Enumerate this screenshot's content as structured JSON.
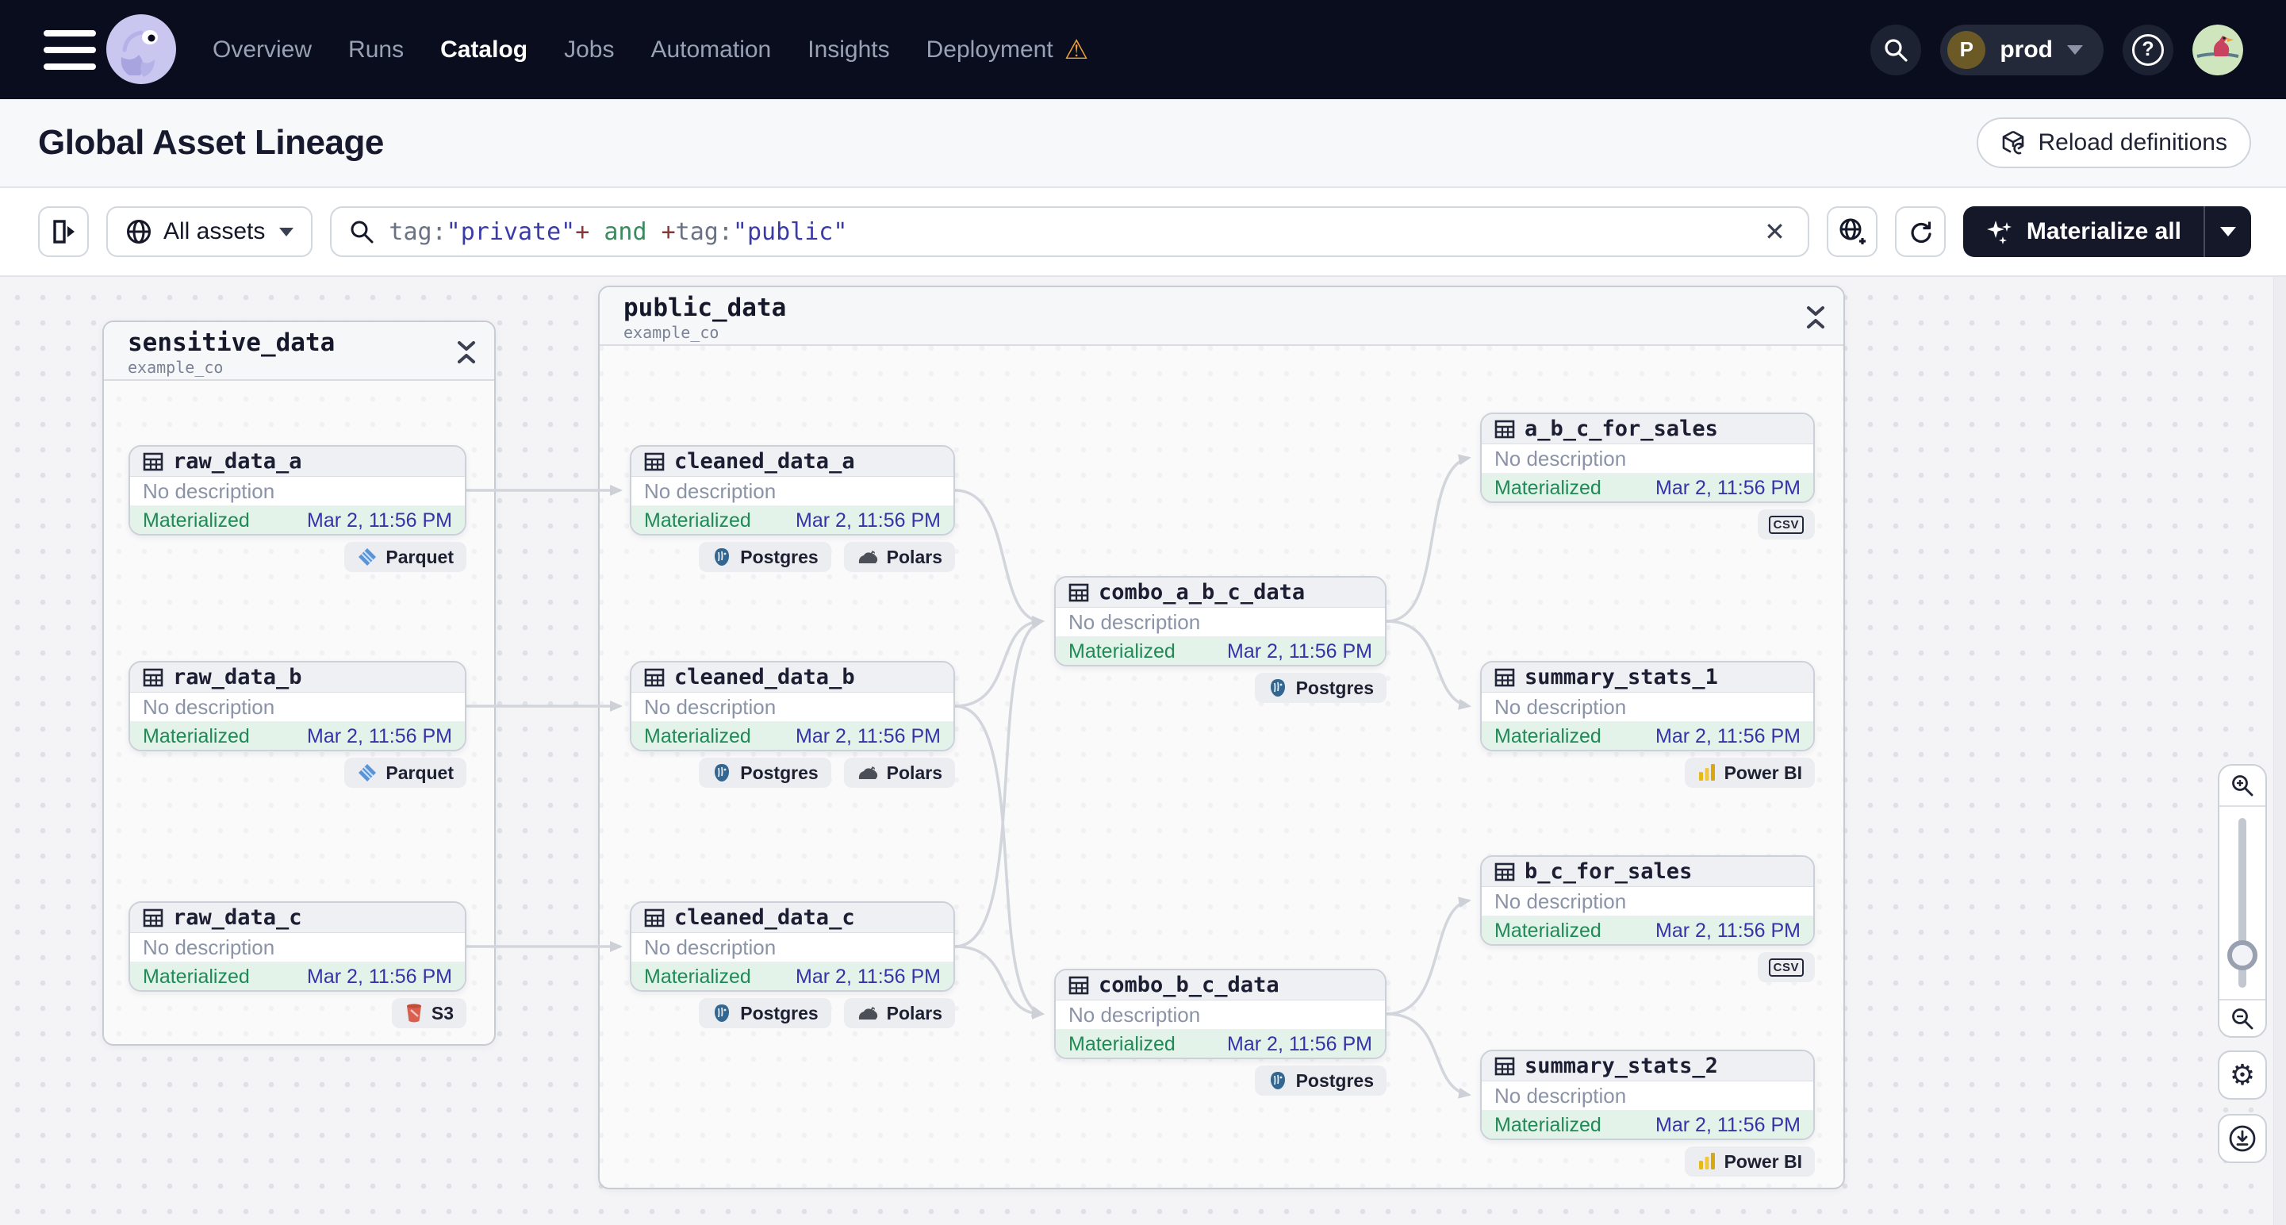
{
  "nav": {
    "items": [
      "Overview",
      "Runs",
      "Catalog",
      "Jobs",
      "Automation",
      "Insights",
      "Deployment"
    ],
    "active_item": "Catalog",
    "deployment_warning_icon": "warning-triangle",
    "environment": {
      "initial": "P",
      "name": "prod"
    }
  },
  "header": {
    "title": "Global Asset Lineage",
    "reload_button_label": "Reload definitions"
  },
  "toolbar": {
    "scope_label": "All assets",
    "query_tokens": [
      {
        "text": "tag:",
        "type": "key"
      },
      {
        "text": "\"private\"",
        "type": "value"
      },
      {
        "text": "+",
        "type": "op"
      },
      {
        "text": " and ",
        "type": "and"
      },
      {
        "text": "+",
        "type": "op"
      },
      {
        "text": "tag:",
        "type": "key"
      },
      {
        "text": "\"public\"",
        "type": "value"
      }
    ],
    "materialize_label": "Materialize all"
  },
  "graph": {
    "groups": [
      {
        "name": "sensitive_data",
        "repo": "example_co"
      },
      {
        "name": "public_data",
        "repo": "example_co"
      }
    ],
    "assets": [
      {
        "name": "raw_data_a",
        "description": "No description",
        "status": "Materialized",
        "date": "Mar 2, 11:56 PM",
        "badges": [
          "Parquet"
        ]
      },
      {
        "name": "raw_data_b",
        "description": "No description",
        "status": "Materialized",
        "date": "Mar 2, 11:56 PM",
        "badges": [
          "Parquet"
        ]
      },
      {
        "name": "raw_data_c",
        "description": "No description",
        "status": "Materialized",
        "date": "Mar 2, 11:56 PM",
        "badges": [
          "S3"
        ]
      },
      {
        "name": "cleaned_data_a",
        "description": "No description",
        "status": "Materialized",
        "date": "Mar 2, 11:56 PM",
        "badges": [
          "Postgres",
          "Polars"
        ]
      },
      {
        "name": "cleaned_data_b",
        "description": "No description",
        "status": "Materialized",
        "date": "Mar 2, 11:56 PM",
        "badges": [
          "Postgres",
          "Polars"
        ]
      },
      {
        "name": "cleaned_data_c",
        "description": "No description",
        "status": "Materialized",
        "date": "Mar 2, 11:56 PM",
        "badges": [
          "Postgres",
          "Polars"
        ]
      },
      {
        "name": "combo_a_b_c_data",
        "description": "No description",
        "status": "Materialized",
        "date": "Mar 2, 11:56 PM",
        "badges": [
          "Postgres"
        ]
      },
      {
        "name": "combo_b_c_data",
        "description": "No description",
        "status": "Materialized",
        "date": "Mar 2, 11:56 PM",
        "badges": [
          "Postgres"
        ]
      },
      {
        "name": "a_b_c_for_sales",
        "description": "No description",
        "status": "Materialized",
        "date": "Mar 2, 11:56 PM",
        "badges": [
          "CSV"
        ]
      },
      {
        "name": "summary_stats_1",
        "description": "No description",
        "status": "Materialized",
        "date": "Mar 2, 11:56 PM",
        "badges": [
          "Power BI"
        ]
      },
      {
        "name": "b_c_for_sales",
        "description": "No description",
        "status": "Materialized",
        "date": "Mar 2, 11:56 PM",
        "badges": [
          "CSV"
        ]
      },
      {
        "name": "summary_stats_2",
        "description": "No description",
        "status": "Materialized",
        "date": "Mar 2, 11:56 PM",
        "badges": [
          "Power BI"
        ]
      }
    ]
  },
  "colors": {
    "nav_bg": "#0a0d1d",
    "accent_dark": "#141829",
    "status_green": "#1f8a55",
    "status_bg": "#e4f3ea",
    "date_indigo": "#3434a8",
    "warning_orange": "#f0a039",
    "edge_gray": "#d2d5db"
  }
}
